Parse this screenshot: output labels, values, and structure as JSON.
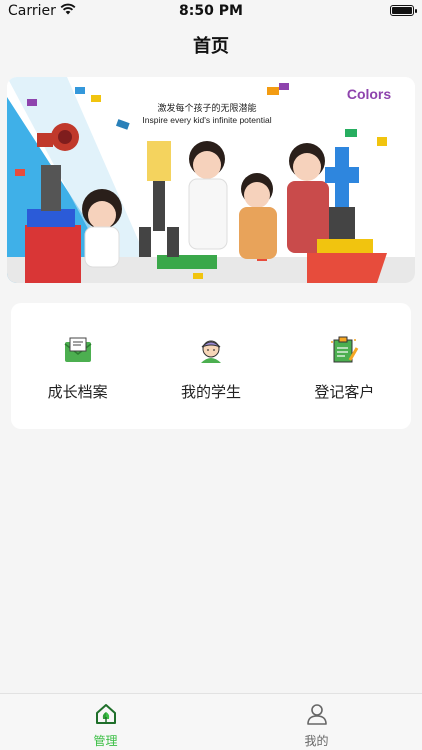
{
  "status_bar": {
    "carrier": "Carrier",
    "time": "8:50 PM"
  },
  "nav": {
    "title": "首页"
  },
  "banner": {
    "slogan_cn": "激发每个孩子的无限潜能",
    "slogan_en": "Inspire every kid's  infinite potential",
    "brand": "Colors"
  },
  "menu": {
    "items": [
      {
        "label": "成长档案",
        "icon": "envelope-icon"
      },
      {
        "label": "我的学生",
        "icon": "student-avatar-icon"
      },
      {
        "label": "登记客户",
        "icon": "clipboard-icon"
      }
    ]
  },
  "tab_bar": {
    "tabs": [
      {
        "label": "管理",
        "icon": "home-icon",
        "active": true
      },
      {
        "label": "我的",
        "icon": "person-icon",
        "active": false
      }
    ],
    "active_color": "#3bbf45",
    "inactive_color": "#666666"
  }
}
